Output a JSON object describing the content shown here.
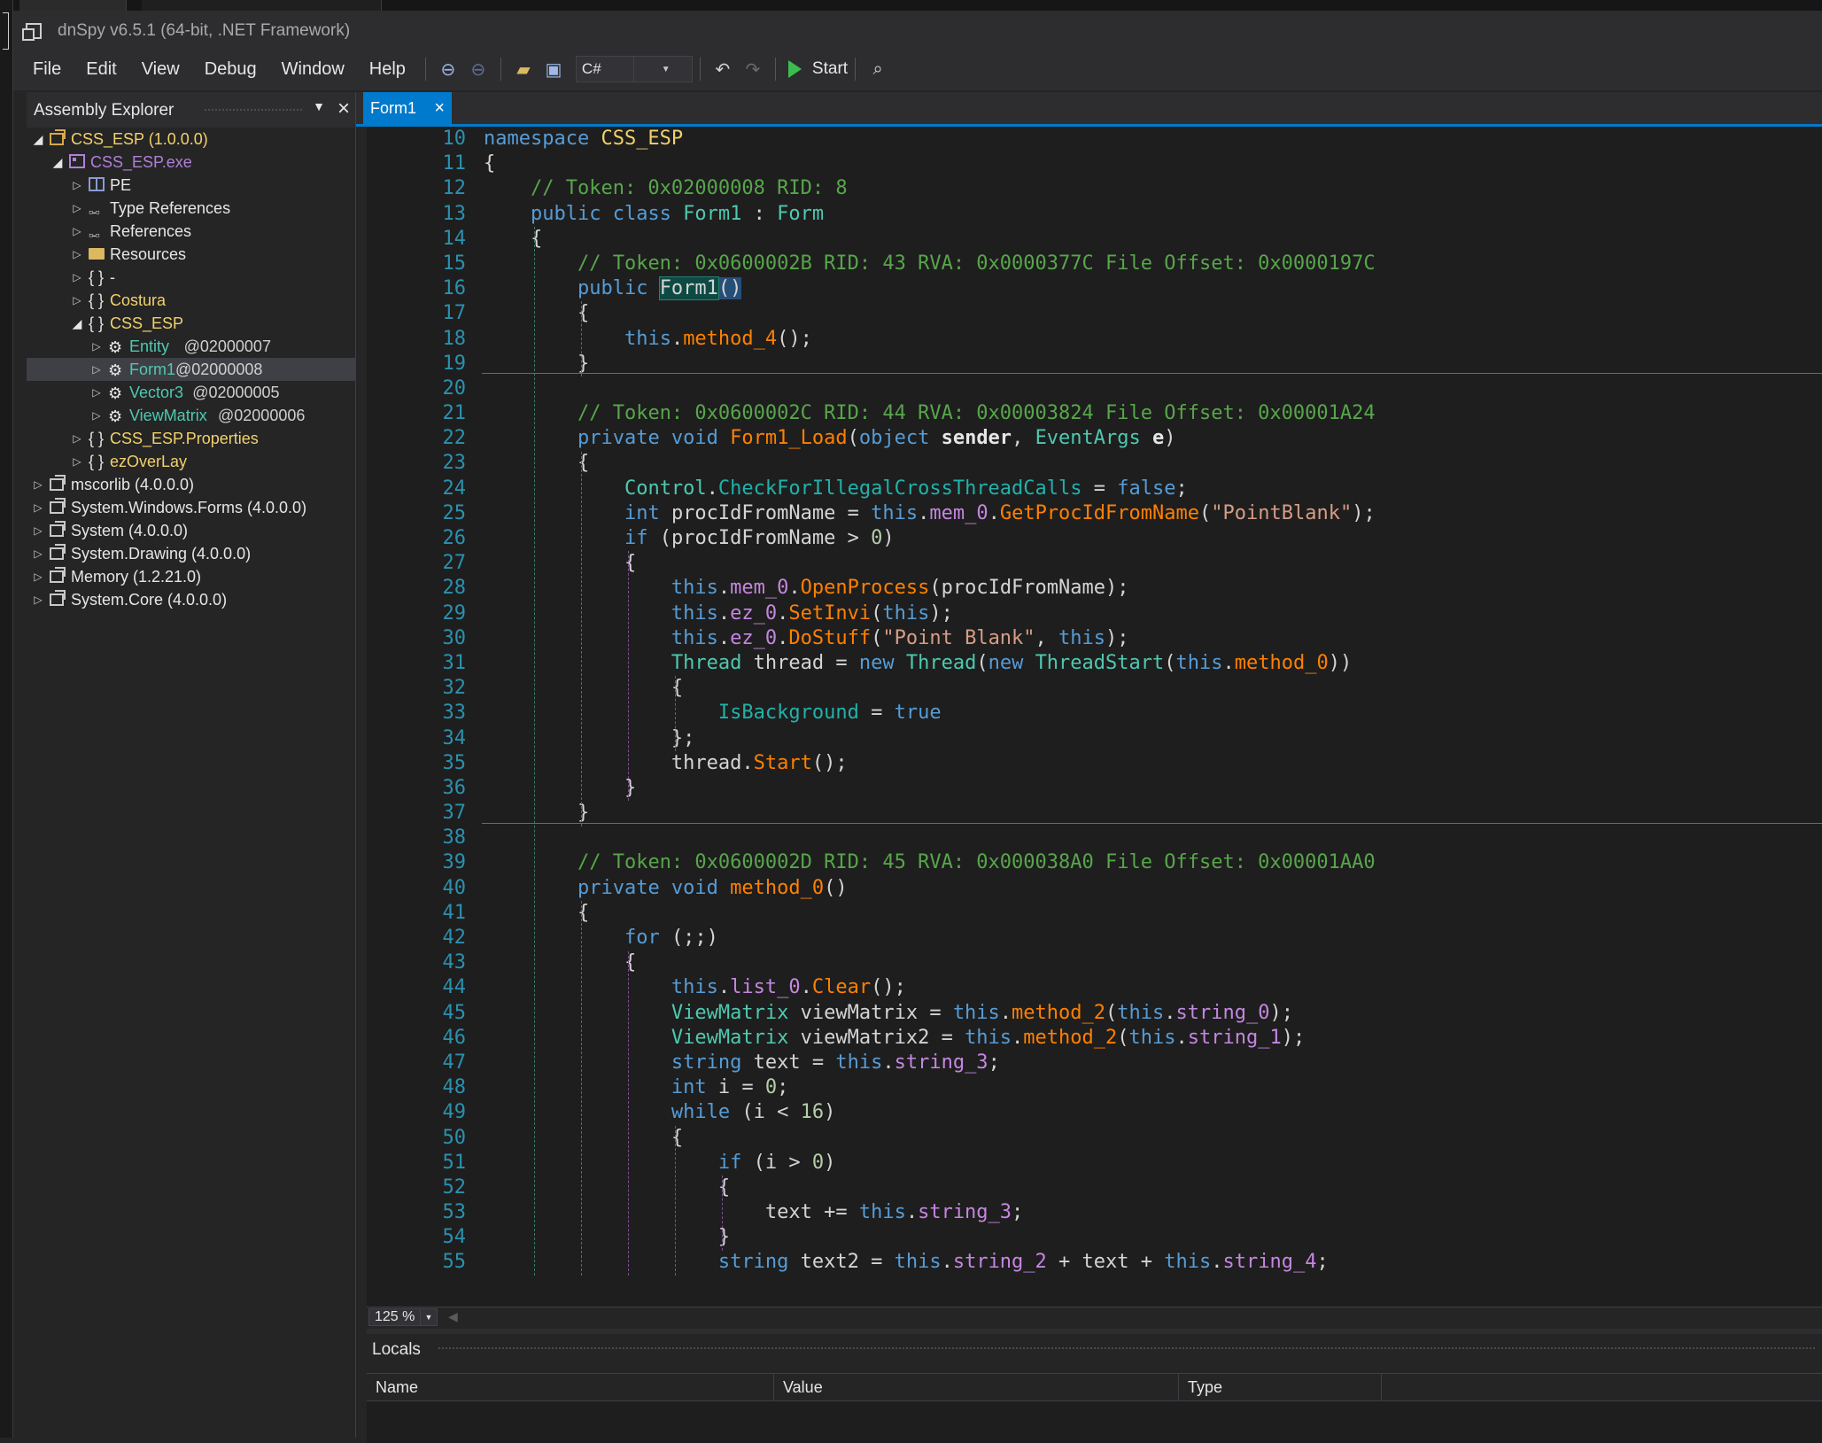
{
  "window": {
    "title": "dnSpy v6.5.1 (64-bit, .NET Framework)"
  },
  "menu": [
    "File",
    "Edit",
    "View",
    "Debug",
    "Window",
    "Help"
  ],
  "toolbar": {
    "language": "C#",
    "start_label": "Start"
  },
  "assembly_explorer": {
    "title": "Assembly Explorer",
    "nodes": [
      {
        "label": "CSS_ESP (1.0.0.0)",
        "level": 0,
        "icon": "assembly-icon",
        "color": "#f2d16a",
        "expanded": true
      },
      {
        "label": "CSS_ESP.exe",
        "level": 1,
        "icon": "module-icon",
        "color": "#b180d7",
        "expanded": true
      },
      {
        "label": "PE",
        "level": 2,
        "icon": "pe-icon",
        "color": "#e6e6e6"
      },
      {
        "label": "Type References",
        "level": 2,
        "icon": "reference-icon",
        "color": "#e6e6e6"
      },
      {
        "label": "References",
        "level": 2,
        "icon": "reference-icon",
        "color": "#e6e6e6"
      },
      {
        "label": "Resources",
        "level": 2,
        "icon": "folder-icon",
        "color": "#e6e6e6"
      },
      {
        "label": "-",
        "level": 2,
        "icon": "namespace-icon",
        "color": "#e6e6e6"
      },
      {
        "label": "Costura",
        "level": 2,
        "icon": "namespace-icon",
        "color": "#f2d16a"
      },
      {
        "label": "CSS_ESP",
        "level": 2,
        "icon": "namespace-icon",
        "color": "#f2d16a",
        "expanded": true
      },
      {
        "label": "Entity",
        "token": "@02000007",
        "level": 3,
        "icon": "class-icon",
        "color": "#4ec9b0"
      },
      {
        "label": "Form1",
        "token": "@02000008",
        "level": 3,
        "icon": "class-icon",
        "color": "#4ec9b0",
        "selected": true
      },
      {
        "label": "Vector3",
        "token": "@02000005",
        "level": 3,
        "icon": "class-icon",
        "color": "#4ec9b0"
      },
      {
        "label": "ViewMatrix",
        "token": "@02000006",
        "level": 3,
        "icon": "class-icon",
        "color": "#4ec9b0"
      },
      {
        "label": "CSS_ESP.Properties",
        "level": 2,
        "icon": "namespace-icon",
        "color": "#f2d16a"
      },
      {
        "label": "ezOverLay",
        "level": 2,
        "icon": "namespace-icon",
        "color": "#f2d16a"
      },
      {
        "label": "mscorlib (4.0.0.0)",
        "level": 0,
        "icon": "assembly-icon-white",
        "color": "#e6e6e6"
      },
      {
        "label": "System.Windows.Forms (4.0.0.0)",
        "level": 0,
        "icon": "assembly-icon-white",
        "color": "#e6e6e6"
      },
      {
        "label": "System (4.0.0.0)",
        "level": 0,
        "icon": "assembly-icon-white",
        "color": "#e6e6e6"
      },
      {
        "label": "System.Drawing (4.0.0.0)",
        "level": 0,
        "icon": "assembly-icon-white",
        "color": "#e6e6e6"
      },
      {
        "label": "Memory (1.2.21.0)",
        "level": 0,
        "icon": "assembly-icon-white",
        "color": "#e6e6e6"
      },
      {
        "label": "System.Core (4.0.0.0)",
        "level": 0,
        "icon": "assembly-icon-white",
        "color": "#e6e6e6"
      }
    ]
  },
  "editor": {
    "tab_label": "Form1",
    "zoom": "125 %",
    "lines": [
      {
        "n": "10",
        "t": [
          [
            "k",
            "namespace "
          ],
          [
            "ns",
            "CSS_ESP"
          ]
        ]
      },
      {
        "n": "11",
        "t": [
          [
            "p",
            "{"
          ]
        ]
      },
      {
        "n": "12",
        "t": [
          [
            "p",
            "    "
          ],
          [
            "c",
            "// Token: 0x02000008 RID: 8"
          ]
        ]
      },
      {
        "n": "13",
        "t": [
          [
            "p",
            "    "
          ],
          [
            "k",
            "public class "
          ],
          [
            "ty",
            "Form1"
          ],
          [
            "p",
            " : "
          ],
          [
            "ty",
            "Form"
          ]
        ]
      },
      {
        "n": "14",
        "t": [
          [
            "p",
            "    {"
          ]
        ]
      },
      {
        "n": "15",
        "t": [
          [
            "p",
            "        "
          ],
          [
            "c",
            "// Token: 0x0600002B RID: 43 RVA: 0x0000377C File Offset: 0x0000197C"
          ]
        ]
      },
      {
        "n": "16",
        "t": [
          [
            "p",
            "        "
          ],
          [
            "k",
            "public "
          ],
          [
            "hl",
            "Form1"
          ],
          [
            "hl2",
            "()"
          ]
        ]
      },
      {
        "n": "17",
        "t": [
          [
            "p",
            "        {"
          ]
        ]
      },
      {
        "n": "18",
        "t": [
          [
            "p",
            "            "
          ],
          [
            "k",
            "this"
          ],
          [
            "p",
            "."
          ],
          [
            "m",
            "method_4"
          ],
          [
            "p",
            "();"
          ]
        ]
      },
      {
        "n": "19",
        "t": [
          [
            "p",
            "        }"
          ]
        ]
      },
      {
        "n": "20",
        "t": [
          [
            "p",
            ""
          ]
        ]
      },
      {
        "n": "21",
        "t": [
          [
            "p",
            "        "
          ],
          [
            "c",
            "// Token: 0x0600002C RID: 44 RVA: 0x00003824 File Offset: 0x00001A24"
          ]
        ]
      },
      {
        "n": "22",
        "t": [
          [
            "p",
            "        "
          ],
          [
            "k",
            "private void "
          ],
          [
            "m",
            "Form1_Load"
          ],
          [
            "p",
            "("
          ],
          [
            "k",
            "object "
          ],
          [
            "pm",
            "sender"
          ],
          [
            "p",
            ", "
          ],
          [
            "ty",
            "EventArgs "
          ],
          [
            "pm",
            "e"
          ],
          [
            "p",
            ")"
          ]
        ]
      },
      {
        "n": "23",
        "t": [
          [
            "p",
            "        {"
          ]
        ]
      },
      {
        "n": "24",
        "t": [
          [
            "p",
            "            "
          ],
          [
            "ty",
            "Control"
          ],
          [
            "p",
            "."
          ],
          [
            "prop",
            "CheckForIllegalCrossThreadCalls"
          ],
          [
            "p",
            " = "
          ],
          [
            "k",
            "false"
          ],
          [
            "p",
            ";"
          ]
        ]
      },
      {
        "n": "25",
        "t": [
          [
            "p",
            "            "
          ],
          [
            "k",
            "int "
          ],
          [
            "p",
            "procIdFromName = "
          ],
          [
            "k",
            "this"
          ],
          [
            "p",
            "."
          ],
          [
            "f",
            "mem_0"
          ],
          [
            "p",
            "."
          ],
          [
            "m",
            "GetProcIdFromName"
          ],
          [
            "p",
            "("
          ],
          [
            "s",
            "\"PointBlank\""
          ],
          [
            "p",
            ");"
          ]
        ]
      },
      {
        "n": "26",
        "t": [
          [
            "p",
            "            "
          ],
          [
            "k",
            "if "
          ],
          [
            "p",
            "(procIdFromName > "
          ],
          [
            "n",
            "0"
          ],
          [
            "p",
            ")"
          ]
        ]
      },
      {
        "n": "27",
        "t": [
          [
            "p",
            "            {"
          ]
        ]
      },
      {
        "n": "28",
        "t": [
          [
            "p",
            "                "
          ],
          [
            "k",
            "this"
          ],
          [
            "p",
            "."
          ],
          [
            "f",
            "mem_0"
          ],
          [
            "p",
            "."
          ],
          [
            "m",
            "OpenProcess"
          ],
          [
            "p",
            "(procIdFromName);"
          ]
        ]
      },
      {
        "n": "29",
        "t": [
          [
            "p",
            "                "
          ],
          [
            "k",
            "this"
          ],
          [
            "p",
            "."
          ],
          [
            "f",
            "ez_0"
          ],
          [
            "p",
            "."
          ],
          [
            "m",
            "SetInvi"
          ],
          [
            "p",
            "("
          ],
          [
            "k",
            "this"
          ],
          [
            "p",
            ");"
          ]
        ]
      },
      {
        "n": "30",
        "t": [
          [
            "p",
            "                "
          ],
          [
            "k",
            "this"
          ],
          [
            "p",
            "."
          ],
          [
            "f",
            "ez_0"
          ],
          [
            "p",
            "."
          ],
          [
            "m",
            "DoStuff"
          ],
          [
            "p",
            "("
          ],
          [
            "s",
            "\"Point Blank\""
          ],
          [
            "p",
            ", "
          ],
          [
            "k",
            "this"
          ],
          [
            "p",
            ");"
          ]
        ]
      },
      {
        "n": "31",
        "t": [
          [
            "p",
            "                "
          ],
          [
            "ty",
            "Thread "
          ],
          [
            "p",
            "thread = "
          ],
          [
            "k",
            "new "
          ],
          [
            "ty",
            "Thread"
          ],
          [
            "p",
            "("
          ],
          [
            "k",
            "new "
          ],
          [
            "ty",
            "ThreadStart"
          ],
          [
            "p",
            "("
          ],
          [
            "k",
            "this"
          ],
          [
            "p",
            "."
          ],
          [
            "m",
            "method_0"
          ],
          [
            "p",
            "))"
          ]
        ]
      },
      {
        "n": "32",
        "t": [
          [
            "p",
            "                {"
          ]
        ]
      },
      {
        "n": "33",
        "t": [
          [
            "p",
            "                    "
          ],
          [
            "prop",
            "IsBackground"
          ],
          [
            "p",
            " = "
          ],
          [
            "k",
            "true"
          ]
        ]
      },
      {
        "n": "34",
        "t": [
          [
            "p",
            "                };"
          ]
        ]
      },
      {
        "n": "35",
        "t": [
          [
            "p",
            "                thread."
          ],
          [
            "m",
            "Start"
          ],
          [
            "p",
            "();"
          ]
        ]
      },
      {
        "n": "36",
        "t": [
          [
            "p",
            "            }"
          ]
        ]
      },
      {
        "n": "37",
        "t": [
          [
            "p",
            "        }"
          ]
        ]
      },
      {
        "n": "38",
        "t": [
          [
            "p",
            ""
          ]
        ]
      },
      {
        "n": "39",
        "t": [
          [
            "p",
            "        "
          ],
          [
            "c",
            "// Token: 0x0600002D RID: 45 RVA: 0x000038A0 File Offset: 0x00001AA0"
          ]
        ]
      },
      {
        "n": "40",
        "t": [
          [
            "p",
            "        "
          ],
          [
            "k",
            "private void "
          ],
          [
            "m",
            "method_0"
          ],
          [
            "p",
            "()"
          ]
        ]
      },
      {
        "n": "41",
        "t": [
          [
            "p",
            "        {"
          ]
        ]
      },
      {
        "n": "42",
        "t": [
          [
            "p",
            "            "
          ],
          [
            "k",
            "for "
          ],
          [
            "p",
            "(;;)"
          ]
        ]
      },
      {
        "n": "43",
        "t": [
          [
            "p",
            "            {"
          ]
        ]
      },
      {
        "n": "44",
        "t": [
          [
            "p",
            "                "
          ],
          [
            "k",
            "this"
          ],
          [
            "p",
            "."
          ],
          [
            "f",
            "list_0"
          ],
          [
            "p",
            "."
          ],
          [
            "m",
            "Clear"
          ],
          [
            "p",
            "();"
          ]
        ]
      },
      {
        "n": "45",
        "t": [
          [
            "p",
            "                "
          ],
          [
            "ty",
            "ViewMatrix "
          ],
          [
            "p",
            "viewMatrix = "
          ],
          [
            "k",
            "this"
          ],
          [
            "p",
            "."
          ],
          [
            "m",
            "method_2"
          ],
          [
            "p",
            "("
          ],
          [
            "k",
            "this"
          ],
          [
            "p",
            "."
          ],
          [
            "f",
            "string_0"
          ],
          [
            "p",
            ");"
          ]
        ]
      },
      {
        "n": "46",
        "t": [
          [
            "p",
            "                "
          ],
          [
            "ty",
            "ViewMatrix "
          ],
          [
            "p",
            "viewMatrix2 = "
          ],
          [
            "k",
            "this"
          ],
          [
            "p",
            "."
          ],
          [
            "m",
            "method_2"
          ],
          [
            "p",
            "("
          ],
          [
            "k",
            "this"
          ],
          [
            "p",
            "."
          ],
          [
            "f",
            "string_1"
          ],
          [
            "p",
            ");"
          ]
        ]
      },
      {
        "n": "47",
        "t": [
          [
            "p",
            "                "
          ],
          [
            "k",
            "string "
          ],
          [
            "p",
            "text = "
          ],
          [
            "k",
            "this"
          ],
          [
            "p",
            "."
          ],
          [
            "f",
            "string_3"
          ],
          [
            "p",
            ";"
          ]
        ]
      },
      {
        "n": "48",
        "t": [
          [
            "p",
            "                "
          ],
          [
            "k",
            "int "
          ],
          [
            "p",
            "i = "
          ],
          [
            "n",
            "0"
          ],
          [
            "p",
            ";"
          ]
        ]
      },
      {
        "n": "49",
        "t": [
          [
            "p",
            "                "
          ],
          [
            "k",
            "while "
          ],
          [
            "p",
            "(i < "
          ],
          [
            "n",
            "16"
          ],
          [
            "p",
            ")"
          ]
        ]
      },
      {
        "n": "50",
        "t": [
          [
            "p",
            "                {"
          ]
        ]
      },
      {
        "n": "51",
        "t": [
          [
            "p",
            "                    "
          ],
          [
            "k",
            "if "
          ],
          [
            "p",
            "(i > "
          ],
          [
            "n",
            "0"
          ],
          [
            "p",
            ")"
          ]
        ]
      },
      {
        "n": "52",
        "t": [
          [
            "p",
            "                    {"
          ]
        ]
      },
      {
        "n": "53",
        "t": [
          [
            "p",
            "                        text += "
          ],
          [
            "k",
            "this"
          ],
          [
            "p",
            "."
          ],
          [
            "f",
            "string_3"
          ],
          [
            "p",
            ";"
          ]
        ]
      },
      {
        "n": "54",
        "t": [
          [
            "p",
            "                    }"
          ]
        ]
      },
      {
        "n": "55",
        "t": [
          [
            "p",
            "                    "
          ],
          [
            "k",
            "string "
          ],
          [
            "p",
            "text2 = "
          ],
          [
            "k",
            "this"
          ],
          [
            "p",
            "."
          ],
          [
            "f",
            "string_2"
          ],
          [
            "p",
            " + text + "
          ],
          [
            "k",
            "this"
          ],
          [
            "p",
            "."
          ],
          [
            "f",
            "string_4"
          ],
          [
            "p",
            ";"
          ]
        ]
      }
    ]
  },
  "locals": {
    "title": "Locals",
    "columns": [
      "Name",
      "Value",
      "Type"
    ]
  }
}
